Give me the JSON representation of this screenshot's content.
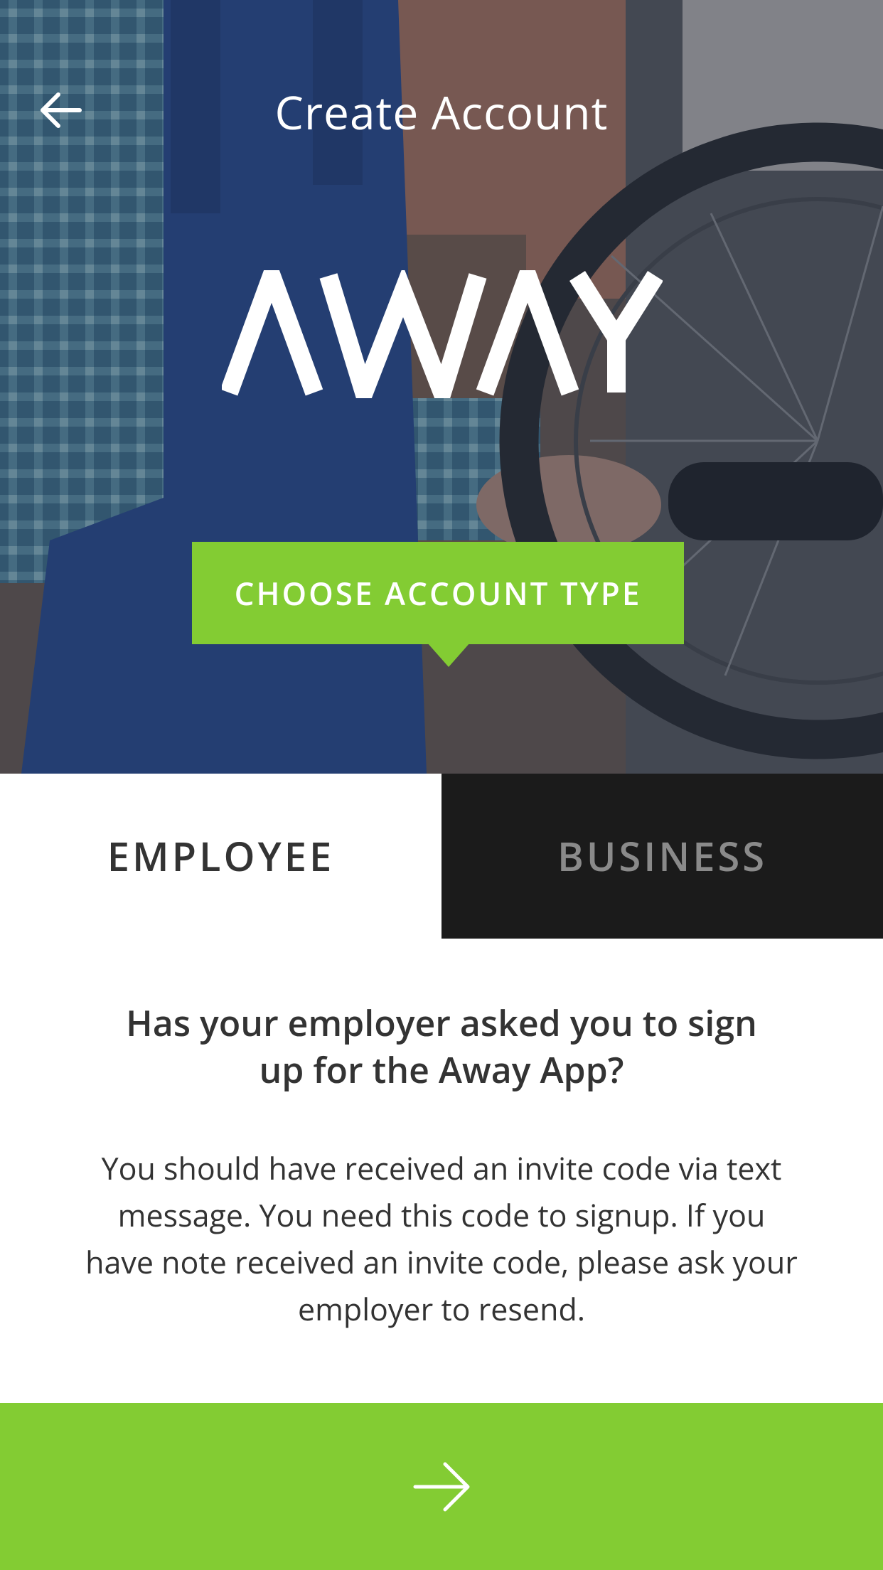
{
  "header": {
    "title": "Create Account",
    "back_icon": "arrow-left-icon"
  },
  "brand": {
    "logo_text": "AWAY"
  },
  "banner": {
    "label": "CHOOSE ACCOUNT TYPE",
    "color": "#83cc33"
  },
  "tabs": [
    {
      "label": "EMPLOYEE",
      "selected": true
    },
    {
      "label": "BUSINESS",
      "selected": false
    }
  ],
  "content": {
    "headline": "Has your employer asked you to sign up for the Away App?",
    "body": "You should have received an invite code via text message. You need this code to signup. If you have note received an invite code, please ask your employer to resend."
  },
  "next_button": {
    "icon": "arrow-right-icon",
    "color": "#83cc33"
  }
}
